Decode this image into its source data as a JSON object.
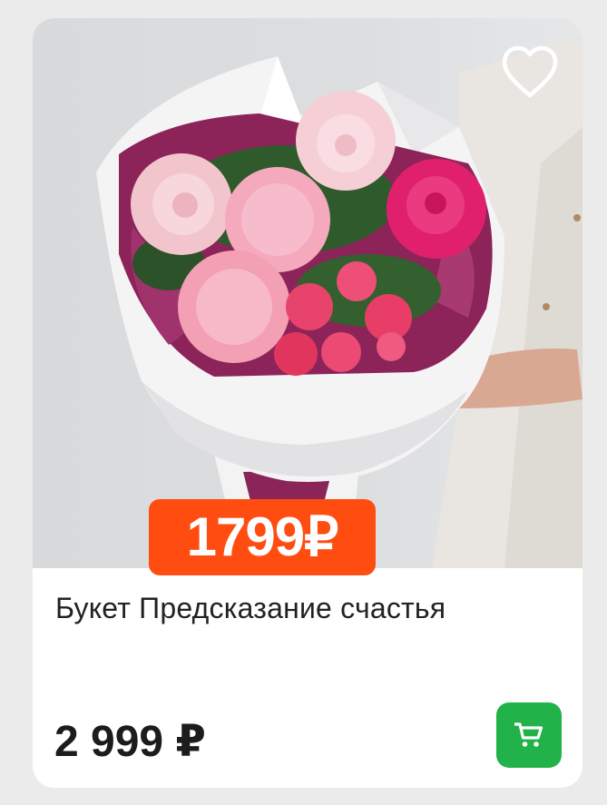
{
  "product": {
    "promo_price": "1799₽",
    "title": "Букет Предсказание счастья",
    "price": "2 999 ₽"
  },
  "icons": {
    "favorite": "heart-outline-icon",
    "cart": "shopping-cart-icon"
  },
  "colors": {
    "promo_badge": "#ff4d12",
    "cart_button": "#21b24a",
    "text": "#222222",
    "card": "#ffffff"
  }
}
